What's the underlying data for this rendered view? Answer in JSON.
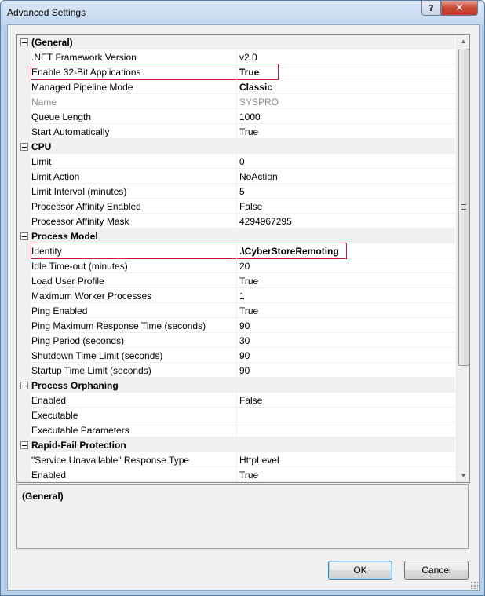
{
  "window": {
    "title": "Advanced Settings",
    "help_label": "?",
    "close_label": "✕"
  },
  "grid": {
    "rows": [
      {
        "type": "category",
        "name": "(General)"
      },
      {
        "type": "prop",
        "name": ".NET Framework Version",
        "value": "v2.0"
      },
      {
        "type": "prop",
        "name": "Enable 32-Bit Applications",
        "value": "True",
        "bold": true,
        "highlight": true
      },
      {
        "type": "prop",
        "name": "Managed Pipeline Mode",
        "value": "Classic",
        "bold": true
      },
      {
        "type": "prop",
        "name": "Name",
        "value": "SYSPRO",
        "grey": true
      },
      {
        "type": "prop",
        "name": "Queue Length",
        "value": "1000"
      },
      {
        "type": "prop",
        "name": "Start Automatically",
        "value": "True"
      },
      {
        "type": "category",
        "name": "CPU"
      },
      {
        "type": "prop",
        "name": "Limit",
        "value": "0"
      },
      {
        "type": "prop",
        "name": "Limit Action",
        "value": "NoAction"
      },
      {
        "type": "prop",
        "name": "Limit Interval (minutes)",
        "value": "5"
      },
      {
        "type": "prop",
        "name": "Processor Affinity Enabled",
        "value": "False"
      },
      {
        "type": "prop",
        "name": "Processor Affinity Mask",
        "value": "4294967295"
      },
      {
        "type": "category",
        "name": "Process Model"
      },
      {
        "type": "prop",
        "name": "Identity",
        "value": ".\\CyberStoreRemoting",
        "bold": true,
        "highlight": true
      },
      {
        "type": "prop",
        "name": "Idle Time-out (minutes)",
        "value": "20"
      },
      {
        "type": "prop",
        "name": "Load User Profile",
        "value": "True"
      },
      {
        "type": "prop",
        "name": "Maximum Worker Processes",
        "value": "1"
      },
      {
        "type": "prop",
        "name": "Ping Enabled",
        "value": "True"
      },
      {
        "type": "prop",
        "name": "Ping Maximum Response Time (seconds)",
        "value": "90"
      },
      {
        "type": "prop",
        "name": "Ping Period (seconds)",
        "value": "30"
      },
      {
        "type": "prop",
        "name": "Shutdown Time Limit (seconds)",
        "value": "90"
      },
      {
        "type": "prop",
        "name": "Startup Time Limit (seconds)",
        "value": "90"
      },
      {
        "type": "category",
        "name": "Process Orphaning"
      },
      {
        "type": "prop",
        "name": "Enabled",
        "value": "False"
      },
      {
        "type": "prop",
        "name": "Executable",
        "value": ""
      },
      {
        "type": "prop",
        "name": "Executable Parameters",
        "value": ""
      },
      {
        "type": "category",
        "name": "Rapid-Fail Protection"
      },
      {
        "type": "prop",
        "name": "\"Service Unavailable\" Response Type",
        "value": "HttpLevel"
      },
      {
        "type": "prop",
        "name": "Enabled",
        "value": "True"
      }
    ]
  },
  "description": {
    "title": "(General)"
  },
  "buttons": {
    "ok_label": "OK",
    "cancel_label": "Cancel"
  }
}
